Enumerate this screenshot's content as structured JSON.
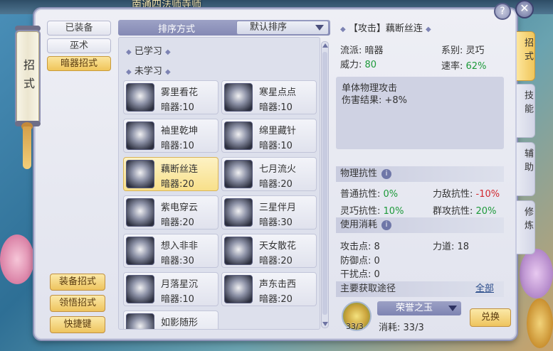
{
  "background": {
    "banner_text": "南通四法师寺师"
  },
  "left_tab": {
    "label": "招式"
  },
  "categories": [
    {
      "label": "已装备",
      "active": false
    },
    {
      "label": "巫术",
      "active": false
    },
    {
      "label": "暗器招式",
      "active": true
    }
  ],
  "bottom_buttons": [
    "装备招式",
    "领悟招式",
    "快捷键"
  ],
  "sort": {
    "label": "排序方式",
    "value": "默认排序"
  },
  "groups": {
    "learned": "已学习",
    "unlearned": "未学习"
  },
  "skills": [
    {
      "name": "雾里看花",
      "level": "暗器:10"
    },
    {
      "name": "寒星点点",
      "level": "暗器:10"
    },
    {
      "name": "袖里乾坤",
      "level": "暗器:10"
    },
    {
      "name": "绵里藏针",
      "level": "暗器:10"
    },
    {
      "name": "藕断丝连",
      "level": "暗器:20"
    },
    {
      "name": "七月流火",
      "level": "暗器:20"
    },
    {
      "name": "紫电穿云",
      "level": "暗器:20"
    },
    {
      "name": "三星伴月",
      "level": "暗器:30"
    },
    {
      "name": "想入非非",
      "level": "暗器:30"
    },
    {
      "name": "天女散花",
      "level": "暗器:20"
    },
    {
      "name": "月落星沉",
      "level": "暗器:10"
    },
    {
      "name": "声东击西",
      "level": "暗器:20"
    },
    {
      "name": "如影随形",
      "level": ""
    }
  ],
  "detail": {
    "title": "【攻击】藕断丝连",
    "school_label": "流派:",
    "school_value": "暗器",
    "series_label": "系别:",
    "series_value": "灵巧",
    "power_label": "威力:",
    "power_value": "80",
    "speed_label": "速率:",
    "speed_value": "62%",
    "desc_line1": "单体物理攻击",
    "desc_line2": "伤害结果: +8%",
    "resist_header": "物理抗性",
    "normal_resist_label": "普通抗性:",
    "normal_resist_value": "0%",
    "force_resist_label": "力敌抗性:",
    "force_resist_value": "-10%",
    "agile_resist_label": "灵巧抗性:",
    "agile_resist_value": "10%",
    "group_resist_label": "群攻抗性:",
    "group_resist_value": "20%",
    "cost_header": "使用消耗",
    "atk_pts_label": "攻击点:",
    "atk_pts_value": "8",
    "force_label": "力道:",
    "force_value": "18",
    "def_pts_label": "防御点:",
    "def_pts_value": "0",
    "disrupt_label": "干扰点:",
    "disrupt_value": "0",
    "source_header": "主要获取途径",
    "source_link": "全部",
    "item_name": "荣誉之玉",
    "item_count": "33/3",
    "consume_label": "消耗:",
    "consume_value": "33/3",
    "exchange_label": "兑换"
  },
  "right_tabs": [
    {
      "label": "招式",
      "active": true
    },
    {
      "label": "技能",
      "active": false
    },
    {
      "label": "辅助",
      "active": false
    },
    {
      "label": "修炼",
      "active": false
    }
  ],
  "colors": {
    "accent_gold": "#f0c55a",
    "positive": "#1d9a3a",
    "negative": "#d2282f",
    "panel_header": "#8489b4"
  }
}
